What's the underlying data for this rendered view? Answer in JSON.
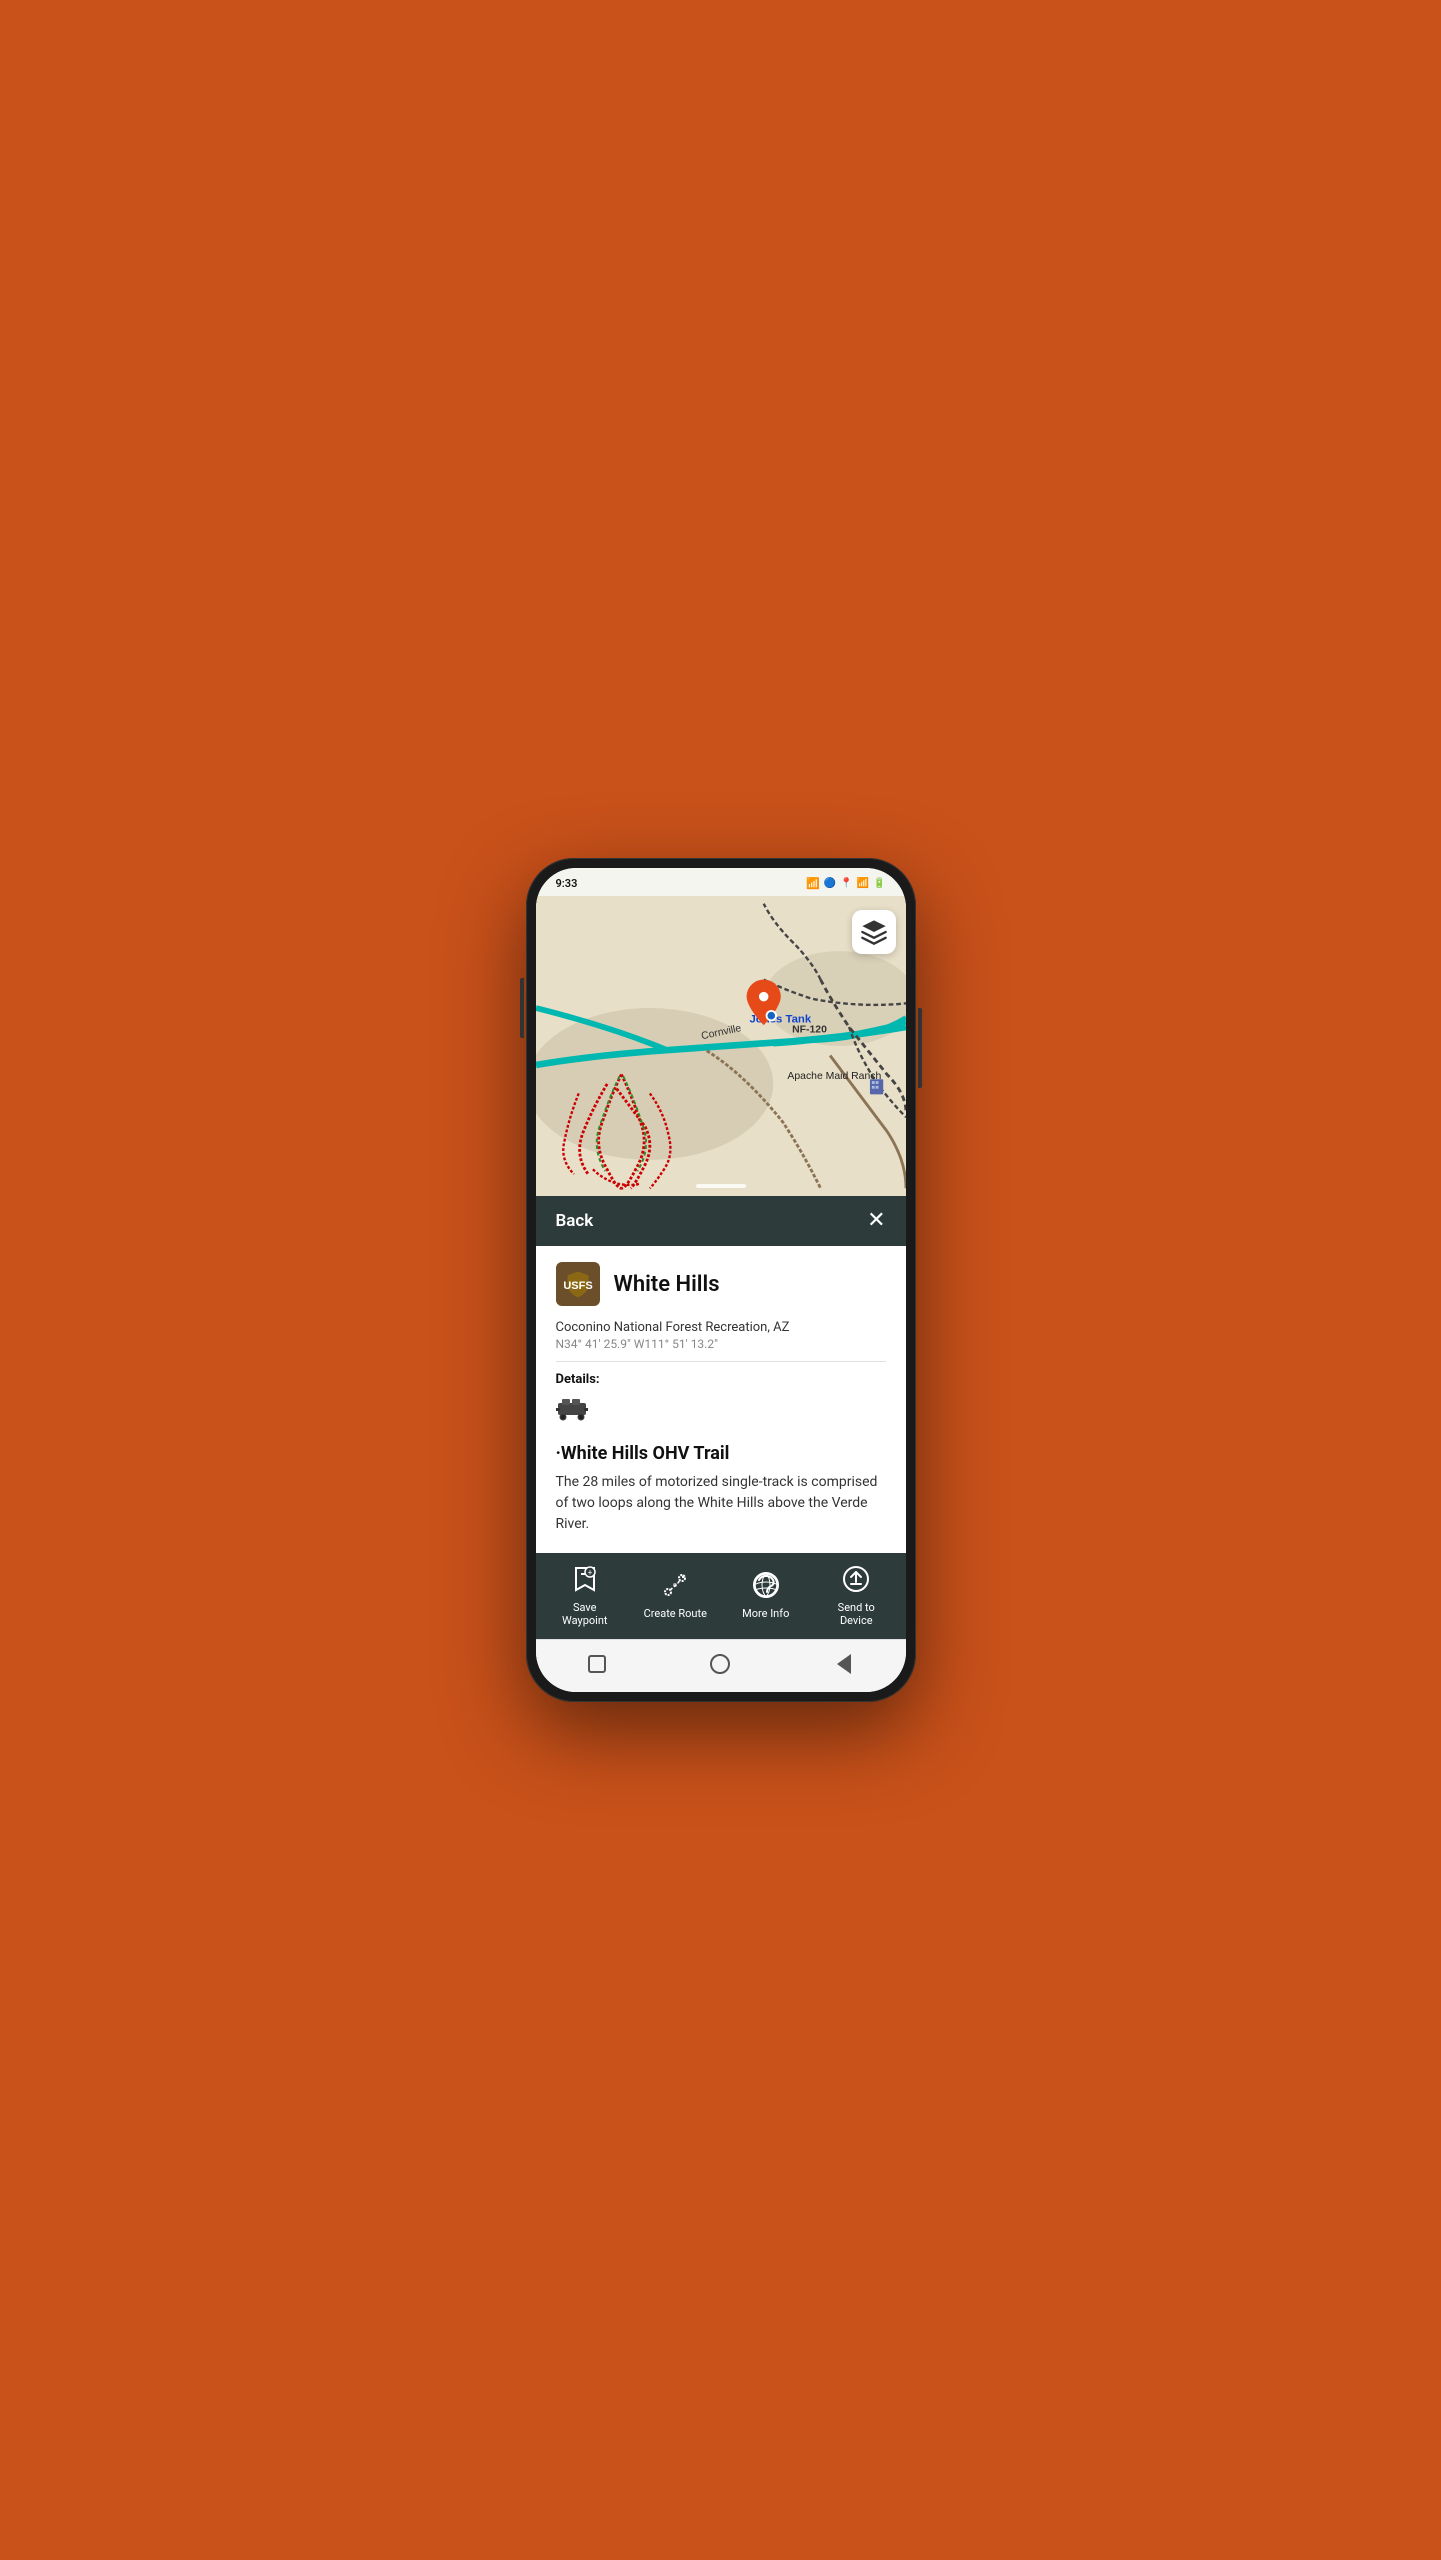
{
  "status_bar": {
    "time": "9:33",
    "signal_icon": "signal",
    "bluetooth_icon": "bluetooth",
    "location_icon": "location",
    "wifi_icon": "wifi",
    "battery_icon": "battery"
  },
  "map": {
    "layer_button_icon": "layers-icon",
    "location_label": "Jones Tank",
    "road_label_1": "Cornville",
    "road_label_2": "NF-120",
    "ranch_label": "Apache Maid Ranch"
  },
  "sheet_header": {
    "back_label": "Back",
    "close_icon": "close-icon"
  },
  "poi": {
    "title": "White Hills",
    "location": "Coconino National Forest Recreation, AZ",
    "coords": "N34° 41' 25.9\" W111° 51' 13.2\"",
    "details_label": "Details:",
    "vehicle_icon": "vehicle-icon"
  },
  "trail": {
    "title": "·White Hills OHV Trail",
    "description": "The 28 miles of motorized single-track is comprised of two loops along the White Hills above the Verde River."
  },
  "action_bar": {
    "save_waypoint_label": "Save\nWaypoint",
    "create_route_label": "Create Route",
    "more_info_label": "More Info",
    "send_to_device_label": "Send to\nDevice",
    "save_icon": "save-waypoint-icon",
    "create_route_icon": "create-route-icon",
    "more_info_icon": "more-info-icon",
    "send_to_device_icon": "send-to-device-icon"
  },
  "nav_bar": {
    "square_icon": "square-icon",
    "circle_icon": "circle-icon",
    "back_icon": "back-icon"
  }
}
